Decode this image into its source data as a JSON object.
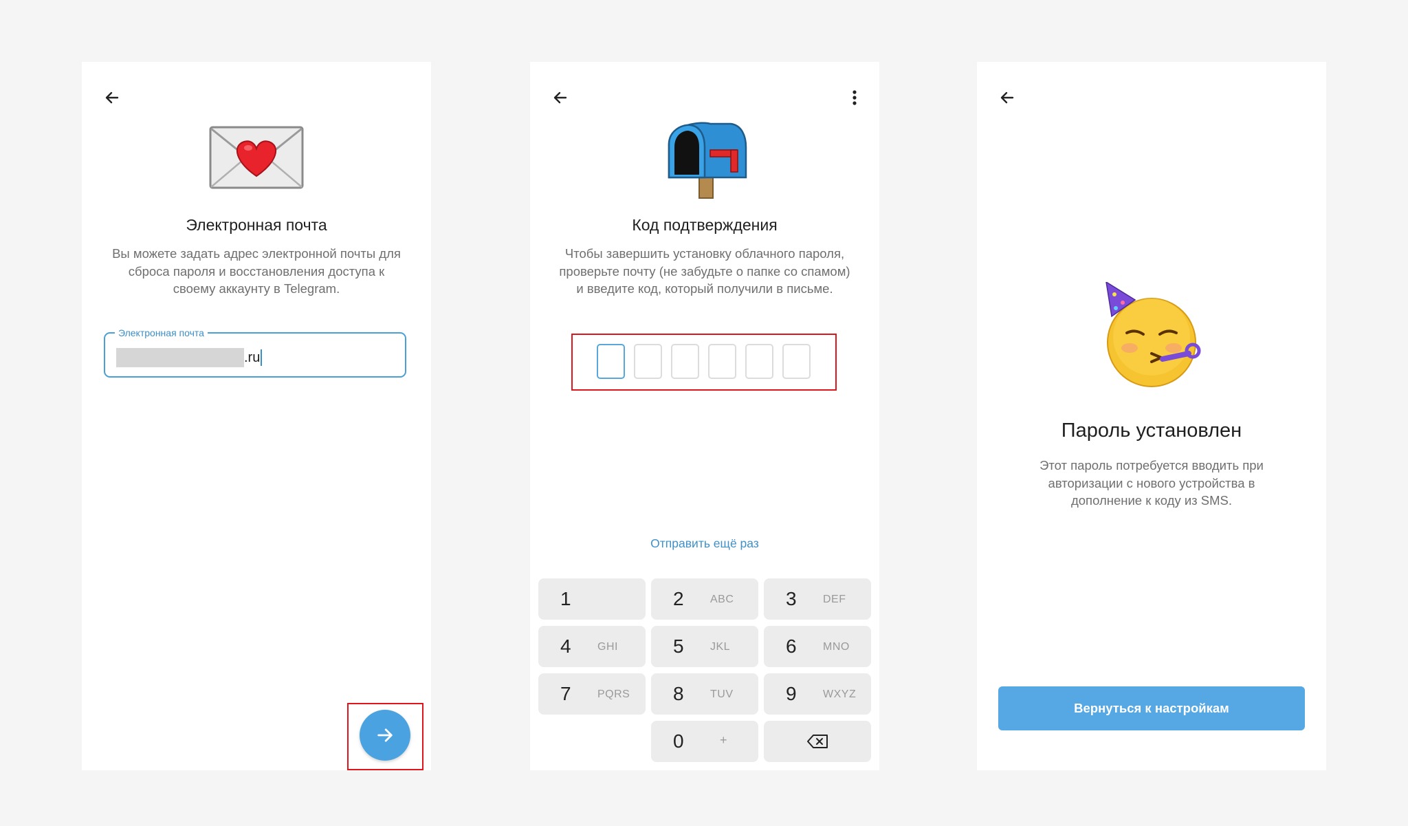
{
  "email_screen": {
    "title": "Электронная почта",
    "description": "Вы можете задать адрес электронной почты для сброса пароля и восстановления доступа к своему аккаунту в Telegram.",
    "field_label": "Электронная почта",
    "field_value_suffix": ".ru",
    "hero_icon": "envelope-heart-icon"
  },
  "code_screen": {
    "title": "Код подтверждения",
    "description": "Чтобы завершить установку облачного пароля, проверьте почту (не забудьте о папке со спамом) и введите код, который получили в письме.",
    "resend_label": "Отправить ещё раз",
    "hero_icon": "mailbox-icon",
    "keys": [
      {
        "num": "1",
        "letters": ""
      },
      {
        "num": "2",
        "letters": "ABC"
      },
      {
        "num": "3",
        "letters": "DEF"
      },
      {
        "num": "4",
        "letters": "GHI"
      },
      {
        "num": "5",
        "letters": "JKL"
      },
      {
        "num": "6",
        "letters": "MNO"
      },
      {
        "num": "7",
        "letters": "PQRS"
      },
      {
        "num": "8",
        "letters": "TUV"
      },
      {
        "num": "9",
        "letters": "WXYZ"
      },
      {
        "num": "0",
        "letters": "+"
      }
    ]
  },
  "done_screen": {
    "title": "Пароль установлен",
    "description": "Этот пароль потребуется вводить при авторизации с нового устройства в дополнение к коду из SMS.",
    "button_label": "Вернуться к настройкам",
    "hero_icon": "party-face-icon"
  },
  "colors": {
    "accent": "#4aa3e0",
    "highlight": "#e0141b",
    "background": "#f5f5f5"
  }
}
